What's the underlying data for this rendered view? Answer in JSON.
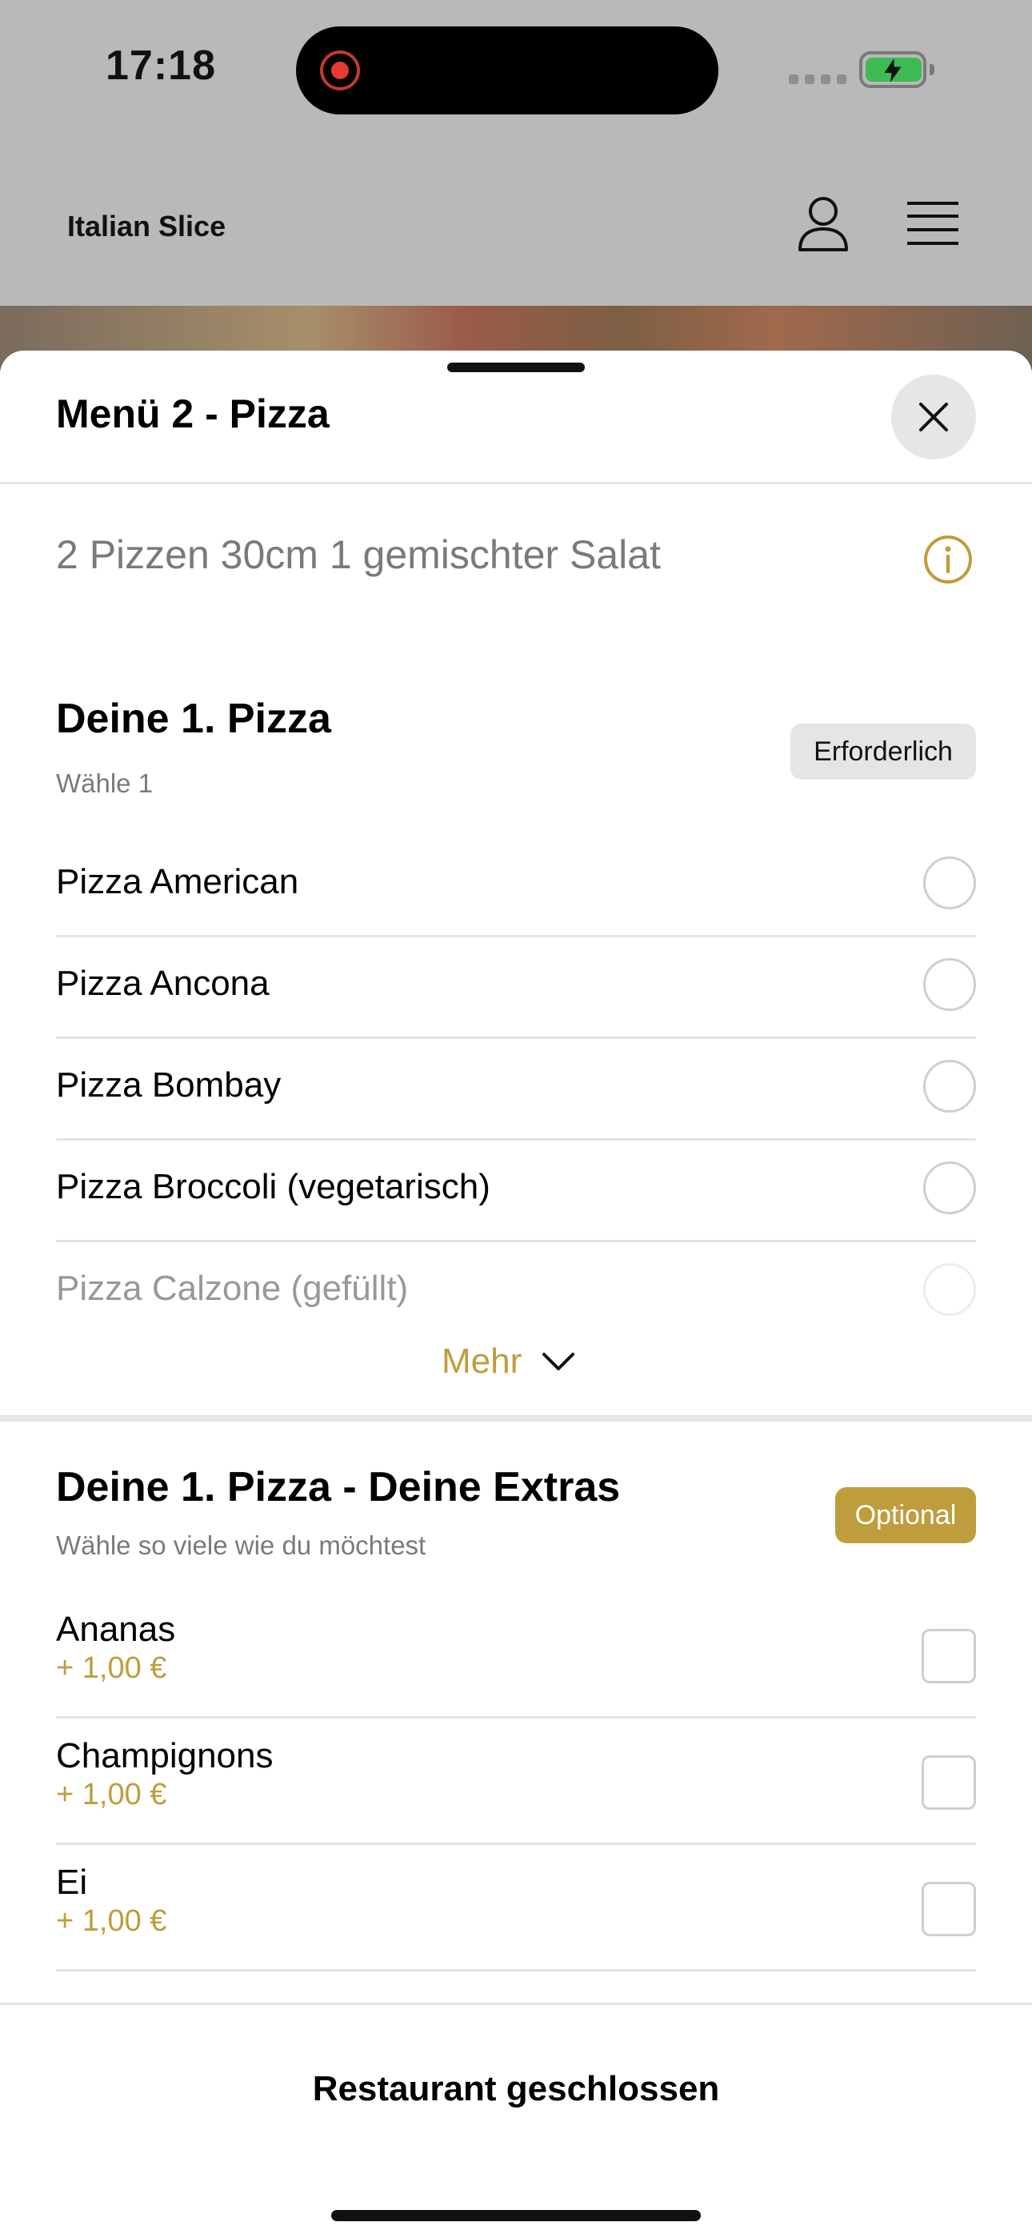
{
  "status_bar": {
    "time": "17:18"
  },
  "header": {
    "title": "Italian Slice"
  },
  "sheet": {
    "title": "Menü 2 - Pizza",
    "description": "2 Pizzen 30cm 1 gemischter Salat",
    "sections": [
      {
        "title": "Deine 1. Pizza",
        "subtitle": "Wähle 1",
        "badge": "Erforderlich",
        "options": [
          {
            "label": "Pizza American",
            "selected": false
          },
          {
            "label": "Pizza Ancona",
            "selected": false
          },
          {
            "label": "Pizza Bombay",
            "selected": false
          },
          {
            "label": "Pizza Broccoli (vegetarisch)",
            "selected": false
          },
          {
            "label": "Pizza Calzone (gefüllt)",
            "selected": false
          }
        ],
        "more_label": "Mehr"
      },
      {
        "title": "Deine 1. Pizza - Deine Extras",
        "subtitle": "Wähle so viele wie du möchtest",
        "badge": "Optional",
        "options": [
          {
            "label": "Ananas",
            "price": "+ 1,00 €",
            "checked": false
          },
          {
            "label": "Champignons",
            "price": "+ 1,00 €",
            "checked": false
          },
          {
            "label": "Ei",
            "price": "+ 1,00 €",
            "checked": false
          }
        ]
      }
    ],
    "footer_label": "Restaurant geschlossen"
  },
  "colors": {
    "accent": "#bf9d3d",
    "overlay": "#b9b9b9",
    "separator": "#e6e6e6"
  }
}
